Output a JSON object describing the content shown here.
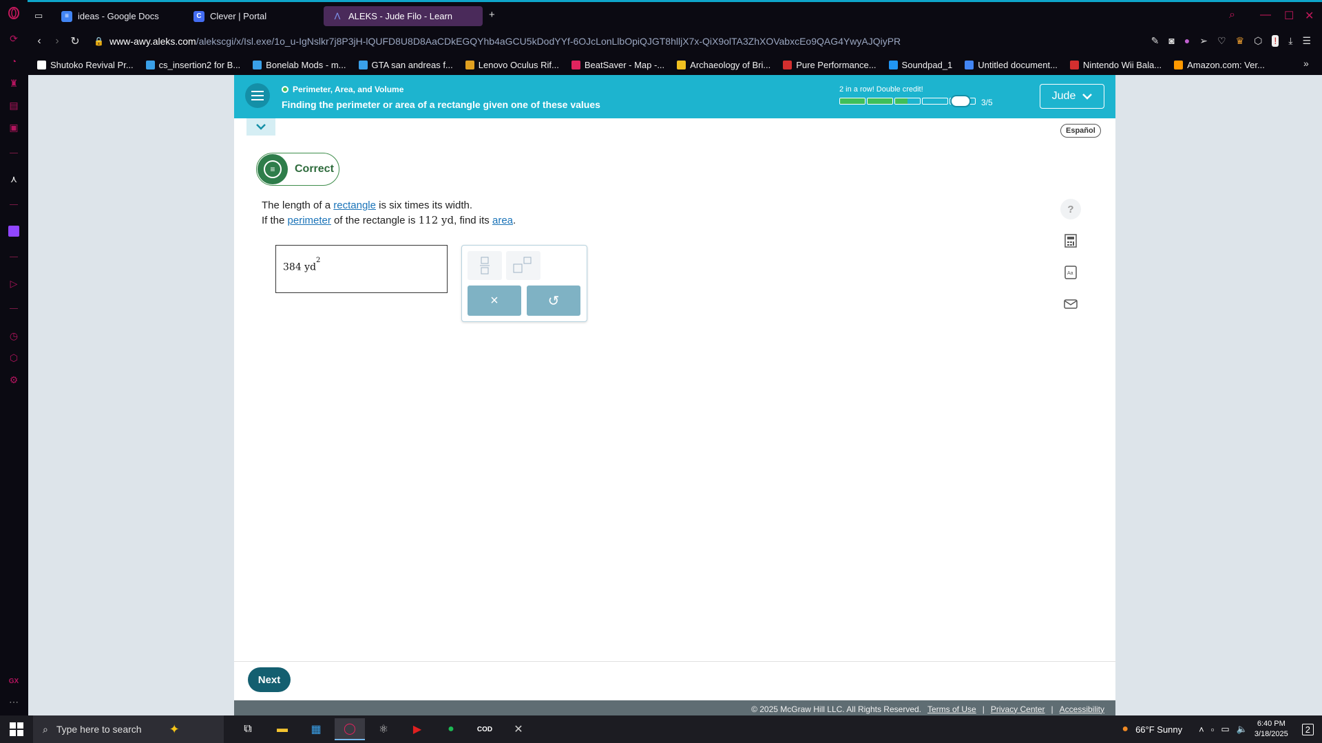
{
  "browser": {
    "tabs": [
      {
        "label": "ideas - Google Docs",
        "icon": "google-docs-icon",
        "color": "#4285f4"
      },
      {
        "label": "Clever | Portal",
        "icon": "clever-icon",
        "color": "#436cf2"
      },
      {
        "label": "ALEKS - Jude Filo - Learn",
        "icon": "aleks-icon",
        "color": "#4a2a5a"
      }
    ],
    "new_tab": "+",
    "url_host": "www-awy.aleks.com",
    "url_path": "/alekscgi/x/Isl.exe/1o_u-IgNslkr7j8P3jH-lQUFD8U8D8AaCDkEGQYhb4aGCU5kDodYYf-6OJcLonLlbOpiQJGT8hlljX7x-QiX9olTA3ZhXOVabxcEo9QAG4YwyAJQiyPR",
    "bookmarks": [
      {
        "label": "Shutoko Revival Pr...",
        "color": "#ffffff"
      },
      {
        "label": "cs_insertion2 for B...",
        "color": "#3aa0e8"
      },
      {
        "label": "Bonelab Mods - m...",
        "color": "#3aa0e8"
      },
      {
        "label": "GTA san andreas f...",
        "color": "#3aa0e8"
      },
      {
        "label": "Lenovo Oculus Rif...",
        "color": "#e0a020"
      },
      {
        "label": "BeatSaver - Map -...",
        "color": "#e0245e"
      },
      {
        "label": "Archaeology of Bri...",
        "color": "#f0c020"
      },
      {
        "label": "Pure Performance...",
        "color": "#d32f2f"
      },
      {
        "label": "Soundpad_1",
        "color": "#2196f3"
      },
      {
        "label": "Untitled document...",
        "color": "#4285f4"
      },
      {
        "label": "Nintendo Wii Bala...",
        "color": "#d32f2f"
      },
      {
        "label": "Amazon.com: Ver...",
        "color": "#ff9900"
      }
    ],
    "bookmarks_more": "»"
  },
  "aleks": {
    "topic": "Perimeter, Area, and Volume",
    "title": "Finding the perimeter or area of a rectangle given one of these values",
    "streak": "2 in a row! Double credit!",
    "progress": {
      "segments": [
        1,
        1,
        0.5,
        0,
        0
      ],
      "count": "3/5"
    },
    "user": "Jude",
    "espanol": "Español",
    "feedback": "Correct",
    "question": {
      "l1_a": "The length of a ",
      "l1_link": "rectangle",
      "l1_b": " is six times its width.",
      "l2_a": "If the ",
      "l2_link1": "perimeter",
      "l2_b": " of the rectangle is ",
      "l2_num": "112 yd",
      "l2_c": ", find its ",
      "l2_link2": "area",
      "l2_d": "."
    },
    "answer": {
      "value": "384 yd",
      "exponent": "2"
    },
    "tools": {
      "clear": "×",
      "undo": "↺"
    },
    "side_help": "?",
    "next": "Next",
    "footer": {
      "copyright": "© 2025 McGraw Hill LLC. All Rights Reserved.",
      "terms": "Terms of Use",
      "privacy": "Privacy Center",
      "accessibility": "Accessibility",
      "sep": "|"
    },
    "colors": {
      "header": "#1db4cf",
      "correct": "#2e7d4a",
      "next": "#145f70"
    }
  },
  "taskbar": {
    "search_placeholder": "Type here to search",
    "weather": "66°F  Sunny",
    "time": "6:40 PM",
    "date": "3/18/2025",
    "notifications": "2"
  }
}
